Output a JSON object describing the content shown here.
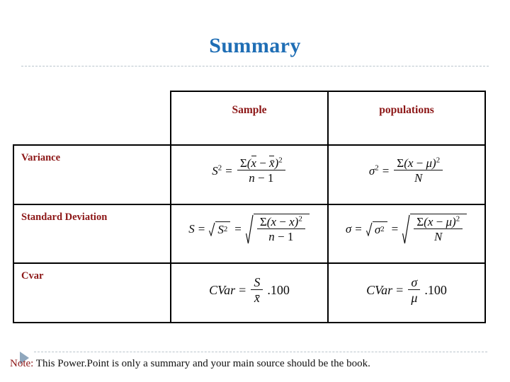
{
  "slide": {
    "title": "Summary"
  },
  "table": {
    "headers": {
      "label": "",
      "sample": "Sample",
      "population": "populations"
    },
    "rows": [
      {
        "label": "Variance",
        "sample": {
          "lhs": "S",
          "lhs_exp": "2",
          "numerator": "Σ(x − x̄)²",
          "denominator": "n − 1",
          "full": "S² = Σ(x − x̄)² / (n − 1)"
        },
        "population": {
          "lhs": "σ",
          "lhs_exp": "2",
          "numerator": "Σ(x − μ)²",
          "denominator": "N",
          "full": "σ² = Σ(x − μ)² / N"
        }
      },
      {
        "label": "Standard Deviation",
        "sample": {
          "lhs": "S",
          "mid": "√S²",
          "numerator": "Σ(x − x̄)²",
          "denominator": "n − 1",
          "full": "S = √S² = √( Σ(x − x̄)² / (n − 1) )"
        },
        "population": {
          "lhs": "σ",
          "mid": "√σ²",
          "numerator": "Σ(x − μ)²",
          "denominator": "N",
          "full": "σ = √σ² = √( Σ(x − μ)² / N )"
        }
      },
      {
        "label": "Cvar",
        "sample": {
          "lhs": "CVar",
          "numerator": "S",
          "denominator": "x̄",
          "factor": ".100",
          "full": "CVar = S / x̄ .100"
        },
        "population": {
          "lhs": "CVar",
          "numerator": "σ",
          "denominator": "μ",
          "factor": ".100",
          "full": "CVar = σ / μ .100"
        }
      }
    ]
  },
  "footer": {
    "keyword": "Note:",
    "text": " This Power.Point is only a summary and your main source should be the book."
  },
  "colors": {
    "title": "#1f6eb5",
    "table_text": "#8c1616",
    "rule": "#b9c4cc",
    "marker": "#8fa7bd",
    "border": "#000000"
  }
}
